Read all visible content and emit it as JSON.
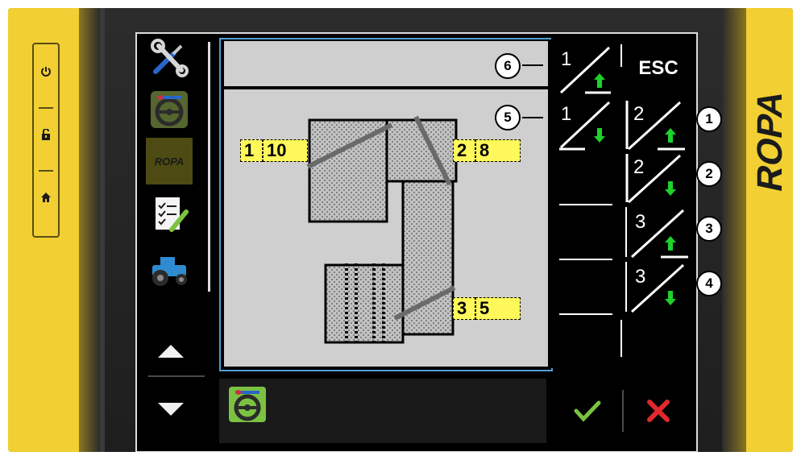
{
  "device": {
    "brand": "ROPA",
    "hardware_buttons": [
      {
        "name": "power",
        "icon": "power-icon"
      },
      {
        "name": "unlock",
        "icon": "unlock-icon"
      },
      {
        "name": "home",
        "icon": "home-icon"
      }
    ]
  },
  "sidebar": {
    "items": [
      {
        "icon": "tools-icon"
      },
      {
        "icon": "steering-wheel-icon"
      },
      {
        "icon": "ropa-logo-icon",
        "label": "ROPA"
      },
      {
        "icon": "checklist-icon"
      },
      {
        "icon": "tractor-icon"
      }
    ],
    "scroll_up_icon": "triangle-up-icon",
    "scroll_down_icon": "triangle-down-icon"
  },
  "diagram": {
    "values": [
      {
        "id": "left",
        "digits": [
          "1",
          "10"
        ]
      },
      {
        "id": "right-top",
        "digits": [
          "2",
          "8"
        ]
      },
      {
        "id": "right-bottom",
        "digits": [
          "3",
          "5"
        ]
      }
    ]
  },
  "keypad": {
    "esc_label": "ESC",
    "keys": [
      {
        "id": "key-1-up",
        "num": "1",
        "dir": "up"
      },
      {
        "id": "key-1-down",
        "num": "1",
        "dir": "down"
      },
      {
        "id": "key-2-up",
        "num": "2",
        "dir": "up"
      },
      {
        "id": "key-2-down",
        "num": "2",
        "dir": "down"
      },
      {
        "id": "key-3-up",
        "num": "3",
        "dir": "up"
      },
      {
        "id": "key-3-down",
        "num": "3",
        "dir": "down"
      }
    ]
  },
  "callouts": {
    "c1": "1",
    "c2": "2",
    "c3": "3",
    "c4": "4",
    "c5": "5",
    "c6": "6"
  },
  "status_bar": {
    "icon": "steering-wheel-icon"
  },
  "actions": {
    "confirm_icon": "checkmark-icon",
    "cancel_icon": "cross-icon"
  },
  "colors": {
    "brand_yellow": "#f2cf33",
    "arrow_green": "#1fd12a",
    "highlight_yellow": "#fff85a",
    "cancel_red": "#e0282d",
    "confirm_green": "#7cc242",
    "frame_blue": "#4f9fd6"
  }
}
